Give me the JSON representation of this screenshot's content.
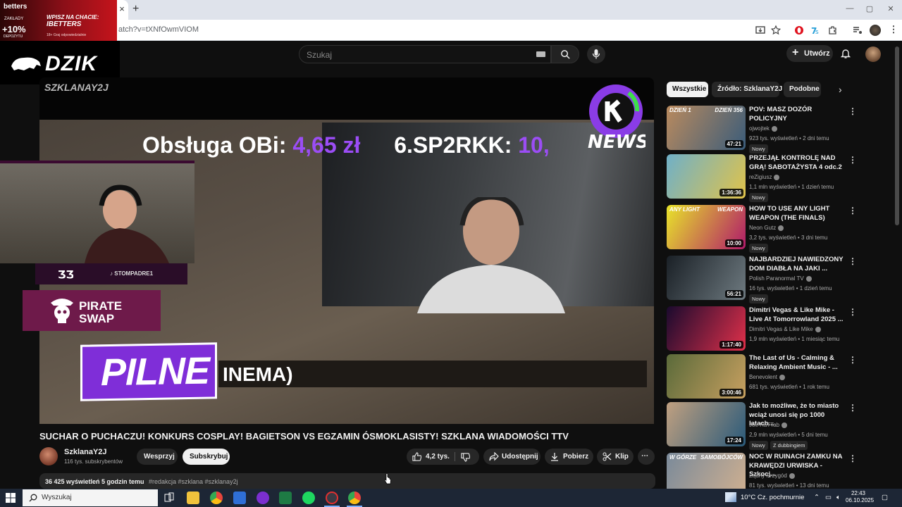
{
  "browser": {
    "url": "atch?v=tXNfOwmVIOM",
    "tab_close": "×",
    "new_tab": "+",
    "win_min": "—",
    "win_max": "▢",
    "win_close": "✕"
  },
  "ad": {
    "brand": "betters",
    "small": "ZAKŁADY",
    "percent": "+10%",
    "small2": "DEPOZYTU",
    "cta_line1": "WPISZ NA CHACIE:",
    "cta_line2": "IBETTERS",
    "fine": "18+ Graj odpowiedzialnie"
  },
  "overlay": {
    "logo_text": "DZIK",
    "channel_watermark": "SZKLANAY2J",
    "ticker_label1": "Obsługa OBi:",
    "ticker_value1": "4,65 zł",
    "ticker_label2": "6.SP2RKK:",
    "ticker_value2": "10,",
    "news_text": "NEWS",
    "tiktok": "STOMPADRE1",
    "sponsor": "PIRATE SWAP",
    "sponsor_line1": "PIRATE",
    "sponsor_line2": "SWAP",
    "pilne": "PILNE",
    "lower_third": "INEMA)"
  },
  "header": {
    "search_placeholder": "Szukaj",
    "create_label": "Utwórz",
    "create_plus": "+"
  },
  "video": {
    "title": "SUCHAR O PUCHACZU! KONKURS COSPLAY! BAGIETSON VS EGZAMIN ÓSMOKLASISTY! SZKLANA WIADOMOŚCI TTV",
    "channel": "SzklanaY2J",
    "subscribers": "116 tys. subskrybentów",
    "support": "Wesprzyj",
    "subscribe": "Subskrybuj",
    "likes": "4,2 tys.",
    "share": "Udostępnij",
    "download": "Pobierz",
    "clip": "Klip",
    "more": "⋯",
    "stats": "36 425 wyświetleń  5 godzin temu",
    "tags": "#redakcja #szklana #szklanay2j"
  },
  "chips": [
    "Wszystkie",
    "Źródło: SzklanaY2J",
    "Podobne"
  ],
  "recommendations": [
    {
      "title": "POV: MASZ DOZÓR POLICYJNY",
      "channel": "ojwojtek",
      "meta": "923 tys. wyświetleń • 2 dni temu",
      "badge": "Nowy",
      "duration": "47:21",
      "thumb_a": "#b98a5e",
      "thumb_b": "#3a5c7a",
      "thumb_text1": "DZIEŃ 1",
      "thumb_text2": "DZIEŃ 356"
    },
    {
      "title": "PRZEJĄŁ KONTROLĘ NAD GRĄ! SABOTAŻYSTA 4 odc.2",
      "channel": "reZigiusz",
      "meta": "1,1 mln wyświetleń • 1 dzień temu",
      "badge": "Nowy",
      "duration": "1:36:36",
      "thumb_a": "#6fb0c8",
      "thumb_b": "#e0c34a"
    },
    {
      "title": "HOW TO USE ANY LIGHT WEAPON (THE FINALS)",
      "channel": "Neon Gutz",
      "meta": "3,2 tys. wyświetleń • 3 dni temu",
      "badge": "Nowy",
      "duration": "10:00",
      "thumb_a": "#e8e42a",
      "thumb_b": "#b01a6a",
      "thumb_text1": "ANY LIGHT",
      "thumb_text2": "WEAPON"
    },
    {
      "title": "NAJBARDZIEJ NAWIEDZONY DOM DIABŁA NA JAKI ...",
      "channel": "Polish Paranormal TV",
      "meta": "16 tys. wyświetleń • 1 dzień temu",
      "badge": "Nowy",
      "duration": "56:21",
      "thumb_a": "#1a2026",
      "thumb_b": "#6e7a80"
    },
    {
      "title": "Dimitri Vegas & Like Mike - Live At Tomorrowland 2025 ...",
      "channel": "Dimitri Vegas & Like Mike",
      "meta": "1,9 mln wyświetleń • 1 miesiąc temu",
      "badge": "",
      "duration": "1:17:40",
      "thumb_a": "#1a0a2e",
      "thumb_b": "#e0304a"
    },
    {
      "title": "The Last of Us - Calming & Relaxing Ambient Music - ...",
      "channel": "Benevolent",
      "meta": "681 tys. wyświetleń • 1 rok temu",
      "badge": "",
      "duration": "3:00:46",
      "thumb_a": "#5a6a3a",
      "thumb_b": "#c8a060"
    },
    {
      "title": "Jak to możliwe, że to miasto wciąż unosi się po 1000 latach...",
      "channel": "Joe HaTTab",
      "meta": "2,9 mln wyświetleń • 5 dni temu",
      "badge": "Nowy",
      "badge2": "Z dubbingiem",
      "duration": "17:24",
      "thumb_a": "#c0a080",
      "thumb_b": "#2a5a7a"
    },
    {
      "title": "NOC W RUINACH ZAMKU NA KRAWĘDZI URWISKA - Szkocj...",
      "channel": "Żądny Przygód",
      "meta": "81 tys. wyświetleń • 13 dni temu",
      "badge": "",
      "duration": "",
      "thumb_a": "#7a8a9a",
      "thumb_b": "#d0b090",
      "thumb_text1": "W GÓRZE",
      "thumb_text2": "SAMOBÓJCÓW"
    }
  ],
  "taskbar": {
    "search": "Wyszukaj",
    "weather": "10°C  Cz. pochmurnie",
    "time": "22:43",
    "date": "06.10.2025"
  },
  "colors": {
    "bg": "#0f0f0f",
    "accent_purple": "#9b4df5",
    "youtube_red": "#ff0033"
  }
}
